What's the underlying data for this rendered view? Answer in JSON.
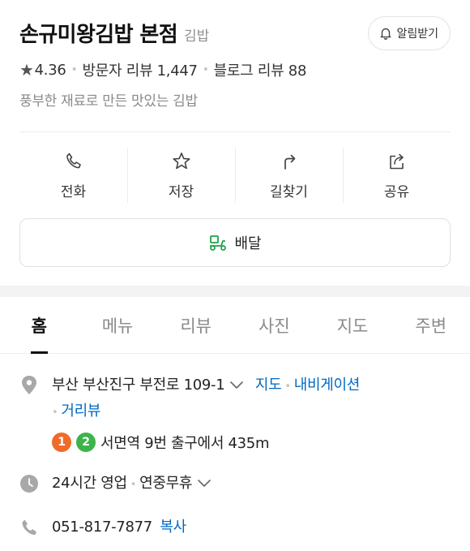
{
  "place": {
    "name": "손규미왕김밥 본점",
    "category": "김밥",
    "rating": "4.36",
    "visitor_reviews": "방문자 리뷰 1,447",
    "blog_reviews": "블로그 리뷰 88",
    "description": "풍부한 재료로 만든 맛있는 김밥"
  },
  "alarm_button": "알림받기",
  "actions": [
    {
      "label": "전화",
      "icon": "phone-icon"
    },
    {
      "label": "저장",
      "icon": "star-icon"
    },
    {
      "label": "길찾기",
      "icon": "directions-icon"
    },
    {
      "label": "공유",
      "icon": "share-icon"
    }
  ],
  "delivery_button": "배달",
  "tabs": [
    {
      "label": "홈",
      "active": true
    },
    {
      "label": "메뉴",
      "active": false
    },
    {
      "label": "리뷰",
      "active": false
    },
    {
      "label": "사진",
      "active": false
    },
    {
      "label": "지도",
      "active": false
    },
    {
      "label": "주변",
      "active": false
    }
  ],
  "info": {
    "address": "부산 부산진구 부전로 109-1",
    "map_link": "지도",
    "navigation_link": "내비게이션",
    "streetview_link": "거리뷰",
    "subway_lines": [
      {
        "number": "1",
        "color": "#f06a29"
      },
      {
        "number": "2",
        "color": "#3cb44a"
      }
    ],
    "subway_text": "서면역 9번 출구에서 435m",
    "hours": "24시간 영업",
    "holiday": "연중무휴",
    "phone": "051-817-7877",
    "copy_link": "복사"
  },
  "colors": {
    "link": "#0068c3",
    "delivery_icon": "#1fa24a",
    "icon_gray": "#9a9a9a"
  }
}
